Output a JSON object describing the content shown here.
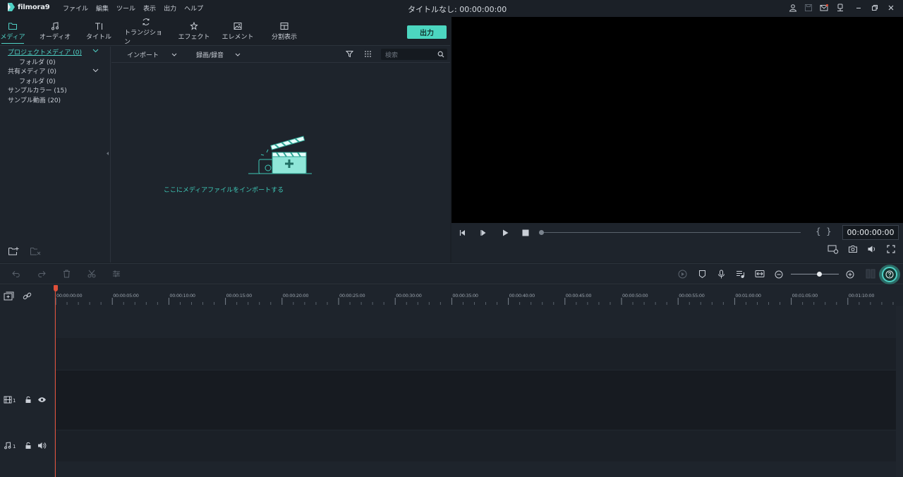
{
  "app": {
    "logo_text": "filmora9",
    "menu": [
      "ファイル",
      "編集",
      "ツール",
      "表示",
      "出力",
      "ヘルプ"
    ],
    "document_title": "タイトルなし: 00:00:00:00"
  },
  "tabs": [
    {
      "label": "メディア",
      "icon": "folder-icon",
      "active": true
    },
    {
      "label": "オーディオ",
      "icon": "music-note-icon"
    },
    {
      "label": "タイトル",
      "icon": "text-icon"
    },
    {
      "label": "トランジション",
      "icon": "transition-icon"
    },
    {
      "label": "エフェクト",
      "icon": "effect-icon"
    },
    {
      "label": "エレメント",
      "icon": "image-icon"
    },
    {
      "label": "分割表示",
      "icon": "split-screen-icon"
    }
  ],
  "export_label": "出力",
  "tree": {
    "items": [
      {
        "label": "プロジェクトメディア (0)",
        "active": true
      },
      {
        "label": "フォルダ (0)"
      },
      {
        "label": "共有メディア (0)"
      },
      {
        "label": "フォルダ (0)"
      },
      {
        "label": "サンプルカラー (15)"
      },
      {
        "label": "サンプル動画 (20)"
      }
    ]
  },
  "media_toolbar": {
    "import_label": "インポート",
    "record_label": "録画/録音",
    "search_placeholder": "検索"
  },
  "import_hint": "ここにメディアファイルをインポートする",
  "preview": {
    "timecode": "00:00:00:00",
    "progress": 0
  },
  "timeline": {
    "ruler_labels": [
      "00:00:00:00",
      "00:00:05:00",
      "00:00:10:00",
      "00:00:15:00",
      "00:00:20:00",
      "00:00:25:00",
      "00:00:30:00",
      "00:00:35:00",
      "00:00:40:00",
      "00:00:45:00",
      "00:00:50:00",
      "00:00:55:00",
      "00:01:00:00",
      "00:01:05:00",
      "00:01:10:00"
    ],
    "video_track_label": "1",
    "audio_track_label": "1",
    "zoom_level": 0.57
  },
  "colors": {
    "accent": "#4fd1c5",
    "playhead": "#e0503a"
  }
}
